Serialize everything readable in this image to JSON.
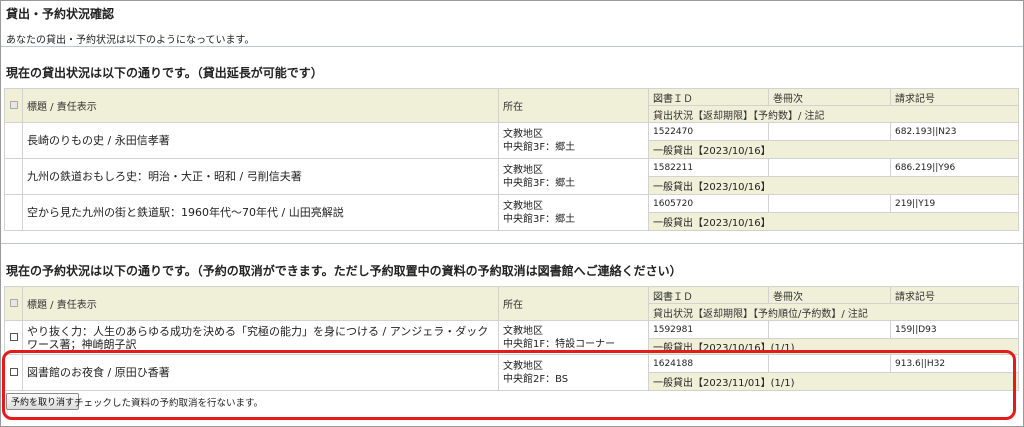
{
  "page": {
    "title": "貸出・予約状況確認",
    "description": "あなたの貸出・予約状況は以下のようになっています。"
  },
  "loans": {
    "heading": "現在の貸出状況は以下の通りです。（貸出延長が可能です）",
    "headers": {
      "title": "標題 / 責任表示",
      "location": "所在",
      "book_id": "図書ＩＤ",
      "volume": "巻冊次",
      "call_number": "請求記号",
      "status": "貸出状況【返却期限】【予約数】/ 注記"
    },
    "rows": [
      {
        "title": "長崎のりもの史 / 永田信孝著",
        "location_1": "文教地区",
        "location_2": "中央館3F：郷土",
        "book_id": "1522470",
        "volume": "",
        "call_number": "682.193||N23",
        "status": "一般貸出【2023/10/16】"
      },
      {
        "title": "九州の鉄道おもしろ史：明治・大正・昭和 / 弓削信夫著",
        "location_1": "文教地区",
        "location_2": "中央館3F：郷土",
        "book_id": "1582211",
        "volume": "",
        "call_number": "686.219||Y96",
        "status": "一般貸出【2023/10/16】"
      },
      {
        "title": "空から見た九州の街と鉄道駅：1960年代～70年代 / 山田亮解説",
        "location_1": "文教地区",
        "location_2": "中央館3F：郷土",
        "book_id": "1605720",
        "volume": "",
        "call_number": "219||Y19",
        "status": "一般貸出【2023/10/16】"
      }
    ]
  },
  "reservations": {
    "heading": "現在の予約状況は以下の通りです。（予約の取消ができます。ただし予約取置中の資料の予約取消は図書館へご連絡ください）",
    "headers": {
      "title": "標題 / 責任表示",
      "location": "所在",
      "book_id": "図書ＩＤ",
      "volume": "巻冊次",
      "call_number": "請求記号",
      "status": "貸出状況【返却期限】【予約順位/予約数】/ 注記"
    },
    "rows": [
      {
        "title": "やり抜く力：人生のあらゆる成功を決める「究極の能力」を身につける / アンジェラ・ダックワース著；神崎朗子訳",
        "location_1": "文教地区",
        "location_2": "中央館1F：特設コーナー",
        "book_id": "1592981",
        "volume": "",
        "call_number": "159||D93",
        "status": "一般貸出【2023/10/16】(1/1)"
      },
      {
        "title": "図書館のお夜食 / 原田ひ香著",
        "location_1": "文教地区",
        "location_2": "中央館2F：BS",
        "book_id": "1624188",
        "volume": "",
        "call_number": "913.6||H32",
        "status": "一般貸出【2023/11/01】(1/1)"
      }
    ],
    "cancel_button": "予約を取り消す",
    "cancel_note": "チェックした資料の予約取消を行ないます。"
  },
  "colors": {
    "header_bg": "#f0f0d8",
    "rule": "#b9c7d8",
    "highlight": "#e51b1b"
  }
}
